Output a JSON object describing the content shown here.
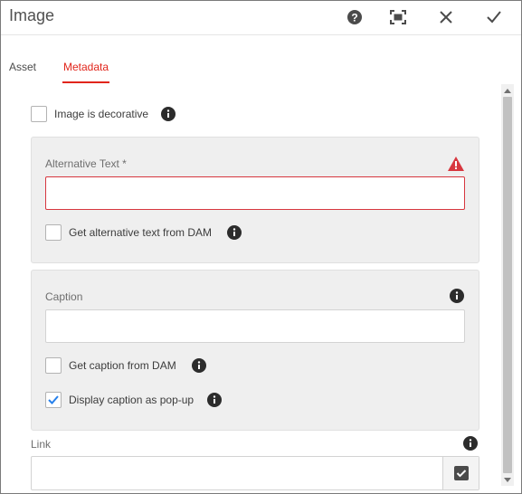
{
  "dialog": {
    "title": "Image",
    "actions": {
      "help_icon": "help-icon",
      "fullscreen_icon": "fullscreen-icon",
      "close_icon": "close-icon",
      "done_icon": "checkmark-icon"
    }
  },
  "tabs": [
    {
      "label": "Asset",
      "active": false
    },
    {
      "label": "Metadata",
      "active": true
    }
  ],
  "form": {
    "decorative": {
      "label": "Image is decorative",
      "checked": false
    },
    "alt_text": {
      "label": "Alternative Text *",
      "value": "",
      "from_dam": {
        "label": "Get alternative text from DAM",
        "checked": false
      }
    },
    "caption": {
      "label": "Caption",
      "value": "",
      "from_dam": {
        "label": "Get caption from DAM",
        "checked": false
      },
      "popup": {
        "label": "Display caption as pop-up",
        "checked": true
      }
    },
    "link": {
      "label": "Link",
      "value": ""
    }
  },
  "colors": {
    "accent": "#e1251b",
    "error": "#d7373f",
    "check": "#2680eb",
    "panel": "#efefef"
  }
}
